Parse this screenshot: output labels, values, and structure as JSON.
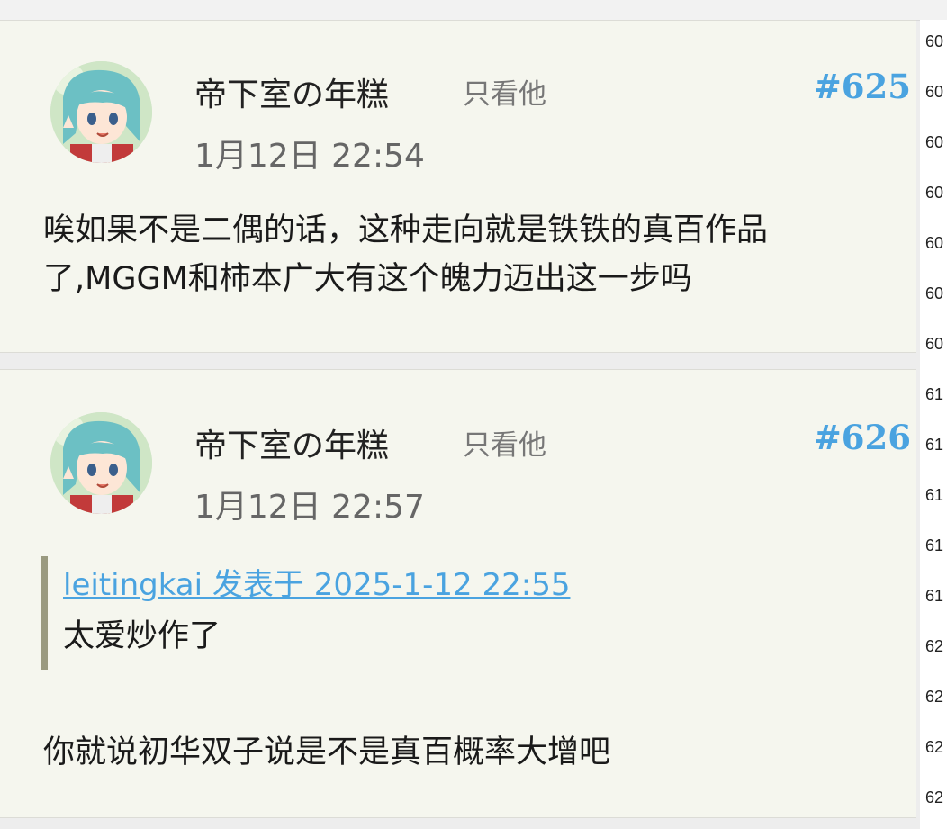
{
  "posts": [
    {
      "username": "帝下室の年糕",
      "only_him": "只看他",
      "floor": "#625",
      "datetime": "1月12日 22:54",
      "body_lines": [
        "唉如果不是二偶的话，这种走向就是铁铁的真百作品",
        "了,MGGM和柿本广大有这个魄力迈出这一步吗"
      ]
    },
    {
      "username": "帝下室の年糕",
      "only_him": "只看他",
      "floor": "#626",
      "datetime": "1月12日 22:57",
      "quote": {
        "link": "leitingkai 发表于 2025-1-12 22:55",
        "text": "太爱炒作了"
      },
      "body_lines": [
        "你就说初华双子说是不是真百概率大增吧"
      ]
    }
  ],
  "gutter_labels": [
    "60",
    "60",
    "60",
    "60",
    "60",
    "60",
    "60",
    "61",
    "61",
    "61",
    "61",
    "61",
    "62",
    "62",
    "62",
    "62"
  ],
  "colors": {
    "floor": "#4aa3e0",
    "link": "#4aa3e0",
    "card_bg": "#f5f6ee",
    "quote_bar": "#9a9a80"
  },
  "icons": {
    "avatar": "anime-avatar-icon"
  }
}
